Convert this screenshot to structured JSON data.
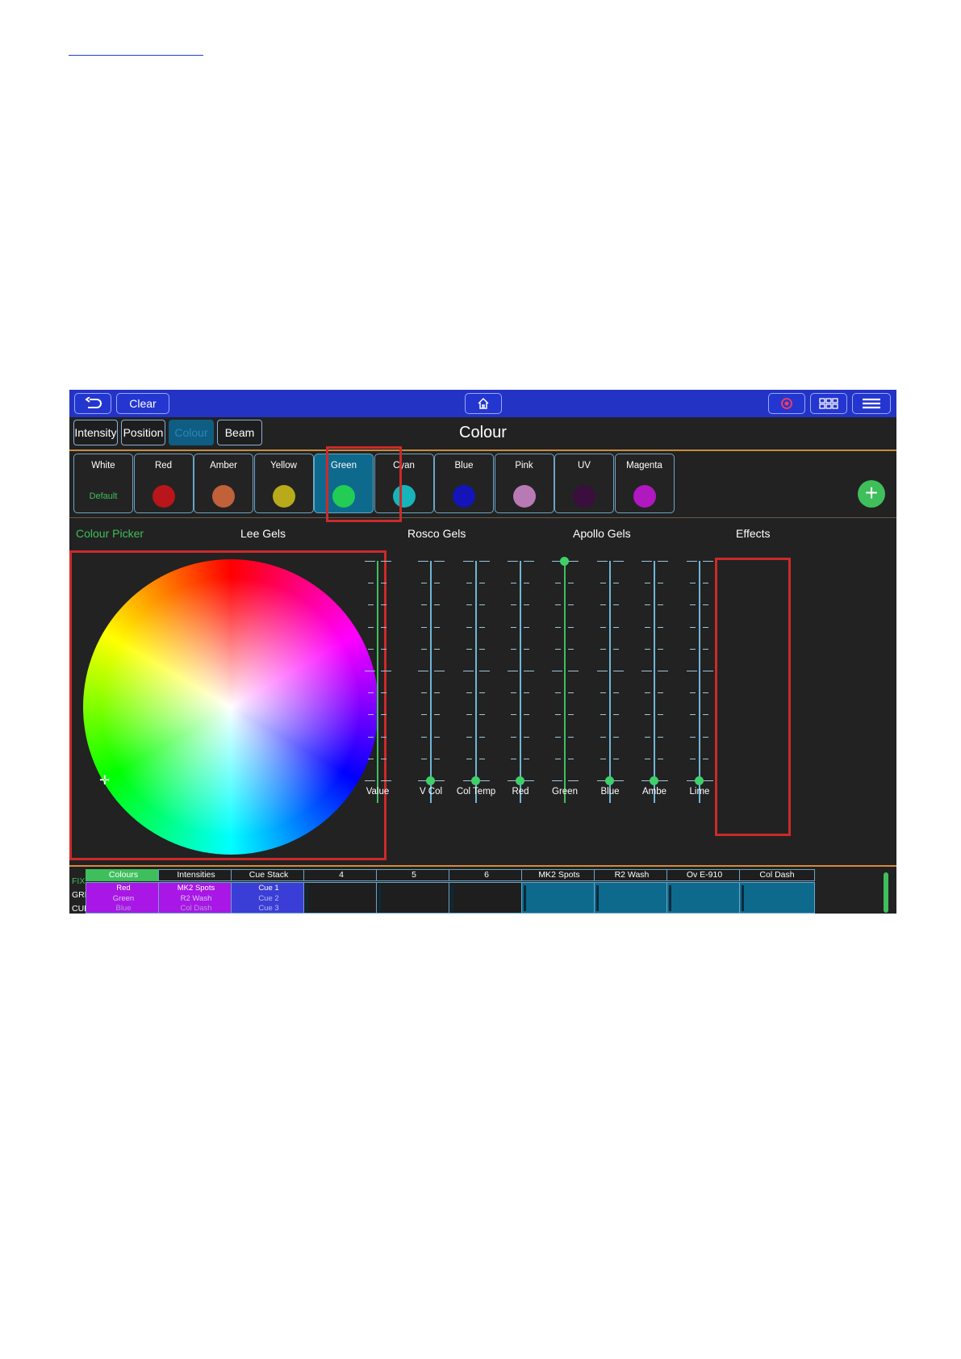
{
  "topbar": {
    "back_icon": "back-arrow-icon",
    "clear_label": "Clear",
    "home_icon": "home-icon",
    "record_icon": "record-icon",
    "grid_icon": "grid-icon",
    "menu_icon": "hamburger-menu-icon",
    "bar_color": "#2333c4"
  },
  "tabs": [
    {
      "label": "Intensity",
      "active": false
    },
    {
      "label": "Position",
      "active": false
    },
    {
      "label": "Colour",
      "active": true
    },
    {
      "label": "Beam",
      "active": false
    }
  ],
  "page_title": "Colour",
  "palettes": [
    {
      "label": "White",
      "sub": "Default",
      "color": "",
      "selected": false
    },
    {
      "label": "Red",
      "color": "#b8161a",
      "selected": false
    },
    {
      "label": "Amber",
      "color": "#c0613a",
      "selected": false
    },
    {
      "label": "Yellow",
      "color": "#b8aa1a",
      "selected": false
    },
    {
      "label": "Green",
      "color": "#22cc55",
      "selected": true
    },
    {
      "label": "Cyan",
      "color": "#17b4ba",
      "selected": false
    },
    {
      "label": "Blue",
      "color": "#1414b8",
      "selected": false
    },
    {
      "label": "Pink",
      "color": "#b87ab4",
      "selected": false
    },
    {
      "label": "UV",
      "color": "#3a0f3e",
      "selected": false
    },
    {
      "label": "Magenta",
      "color": "#b018c0",
      "selected": false
    }
  ],
  "add_icon": "plus-icon",
  "sections": [
    {
      "label": "Colour Picker",
      "active": true
    },
    {
      "label": "Lee Gels",
      "active": false
    },
    {
      "label": "Rosco Gels",
      "active": false
    },
    {
      "label": "Apollo Gels",
      "active": false
    },
    {
      "label": "Effects",
      "active": false
    }
  ],
  "faders": [
    {
      "label": "Value",
      "level": 1.0,
      "track_color": "#3fbf5c",
      "knob": false
    },
    {
      "label": "V Col",
      "level": 0.0,
      "track_color": "#6fb6d8",
      "knob": true
    },
    {
      "label": "Col Temp",
      "level": 0.0,
      "track_color": "#6fb6d8",
      "knob": true
    },
    {
      "label": "Red",
      "level": 0.0,
      "track_color": "#6fb6d8",
      "knob": true
    },
    {
      "label": "Green",
      "level": 1.0,
      "track_color": "#3fbf5c",
      "knob": true
    },
    {
      "label": "Blue",
      "level": 0.0,
      "track_color": "#6fb6d8",
      "knob": true
    },
    {
      "label": "Ambe",
      "level": 0.0,
      "track_color": "#6fb6d8",
      "knob": true
    },
    {
      "label": "Lime",
      "level": 0.0,
      "track_color": "#6fb6d8",
      "knob": true
    }
  ],
  "row_labels": [
    {
      "label": "FIX",
      "active": true
    },
    {
      "label": "GRP",
      "active": false
    },
    {
      "label": "CUE",
      "active": false
    }
  ],
  "playbacks": [
    {
      "title": "Colours",
      "lines": [
        "Red",
        "Green",
        "Blue"
      ],
      "body_color": "#a817e6",
      "active": true
    },
    {
      "title": "Intensities",
      "lines": [
        "MK2 Spots",
        "R2 Wash",
        "Col Dash"
      ],
      "body_color": "#a817e6",
      "active": false
    },
    {
      "title": "Cue Stack",
      "lines": [
        "Cue 1",
        "Cue 2",
        "Cue 3"
      ],
      "body_color": "#3a3ed6",
      "active": false
    },
    {
      "title": "4",
      "lines": [],
      "body_color": "#1e1e1e",
      "active": false
    },
    {
      "title": "5",
      "lines": [],
      "body_color": "#1e1e1e",
      "active": false
    },
    {
      "title": "6",
      "lines": [],
      "body_color": "#1e1e1e",
      "active": false
    },
    {
      "title": "MK2 Spots",
      "lines": [],
      "body_color": "#0e6a8d",
      "active": false
    },
    {
      "title": "R2 Wash",
      "lines": [],
      "body_color": "#0e6a8d",
      "active": false
    },
    {
      "title": "Ov E-910",
      "lines": [],
      "body_color": "#0e6a8d",
      "active": false
    },
    {
      "title": "Col Dash",
      "lines": [],
      "body_color": "#0e6a8d",
      "active": false
    }
  ]
}
